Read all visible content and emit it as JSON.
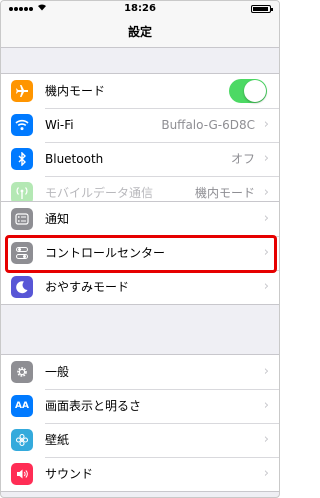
{
  "status_bar": {
    "time": "18:26"
  },
  "nav": {
    "title": "設定"
  },
  "groups": [
    {
      "rows": [
        {
          "label": "機内モード",
          "icon": "airplane-icon",
          "icon_color": "#ff9500",
          "toggle": true
        },
        {
          "label": "Wi-Fi",
          "icon": "wifi-icon",
          "icon_color": "#007aff",
          "value": "Buffalo-G-6D8C"
        },
        {
          "label": "Bluetooth",
          "icon": "bluetooth-icon",
          "icon_color": "#007aff",
          "value": "オフ"
        },
        {
          "label": "モバイルデータ通信",
          "icon": "antenna-icon",
          "icon_color": "#b4e8b4",
          "value": "機内モード",
          "disabled": true
        }
      ]
    },
    {
      "rows": [
        {
          "label": "通知",
          "icon": "notifications-icon",
          "icon_color": "#8e8e93"
        },
        {
          "label": "コントロールセンター",
          "icon": "control-center-icon",
          "icon_color": "#8e8e93",
          "highlighted": true
        },
        {
          "label": "おやすみモード",
          "icon": "moon-icon",
          "icon_color": "#5856d6"
        }
      ]
    },
    {
      "rows": [
        {
          "label": "一般",
          "icon": "gear-icon",
          "icon_color": "#8e8e93"
        },
        {
          "label": "画面表示と明るさ",
          "icon": "display-icon",
          "icon_color": "#007aff"
        },
        {
          "label": "壁紙",
          "icon": "wallpaper-icon",
          "icon_color": "#34aadc"
        },
        {
          "label": "サウンド",
          "icon": "sound-icon",
          "icon_color": "#ff2d55"
        }
      ]
    }
  ],
  "colors": {
    "highlight": "#e60000",
    "toggle_on": "#4cd964"
  }
}
